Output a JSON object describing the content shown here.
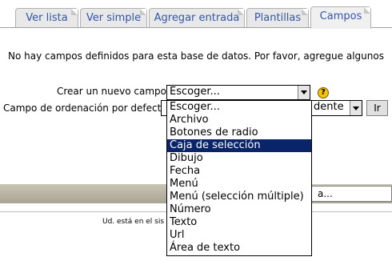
{
  "tabs": [
    {
      "label": "Ver lista",
      "active": false
    },
    {
      "label": "Ver simple",
      "active": false
    },
    {
      "label": "Agregar entrada",
      "active": false
    },
    {
      "label": "Plantillas",
      "active": false
    },
    {
      "label": "Campos",
      "active": true
    }
  ],
  "message": "No hay campos definidos para esta base de datos. Por favor, agregue algunos",
  "create_field": {
    "label": "Crear un nuevo campo:",
    "selected": "Escoger...",
    "help_glyph": "?",
    "options": [
      "Escoger...",
      "Archivo",
      "Botones de radio",
      "Caja de selección",
      "Dibujo",
      "Fecha",
      "Menú",
      "Menú (selección múltiple)",
      "Número",
      "Texto",
      "Url",
      "Área de texto"
    ],
    "highlighted": "Caja de selección"
  },
  "sort_field": {
    "label": "Campo de ordenación por defecto:",
    "order_value": "dente",
    "go_label": "Ir"
  },
  "search": {
    "value": "a..."
  },
  "footer": {
    "text": "Ud. está en el sis"
  },
  "colors": {
    "tab_text": "#3355aa",
    "highlight": "#0a246a",
    "help_icon": "#f5c400"
  }
}
